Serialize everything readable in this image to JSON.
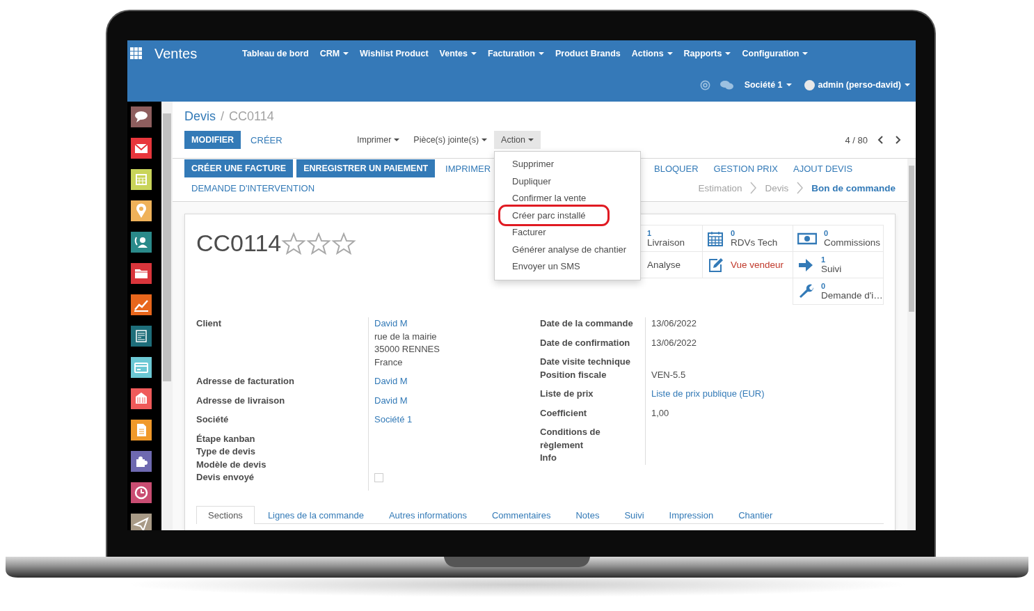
{
  "navbar": {
    "app_title": "Ventes",
    "menus": [
      {
        "label": "Tableau de bord",
        "dropdown": false
      },
      {
        "label": "CRM",
        "dropdown": true
      },
      {
        "label": "Wishlist Product",
        "dropdown": false
      },
      {
        "label": "Ventes",
        "dropdown": true
      },
      {
        "label": "Facturation",
        "dropdown": true
      },
      {
        "label": "Product Brands",
        "dropdown": false
      },
      {
        "label": "Actions",
        "dropdown": true
      },
      {
        "label": "Rapports",
        "dropdown": true
      },
      {
        "label": "Configuration",
        "dropdown": true
      }
    ],
    "company": "Société 1",
    "user": "admin (perso-david)"
  },
  "breadcrumbs": [
    {
      "label": "Devis"
    },
    {
      "label": "CC0114"
    }
  ],
  "breadcrumb_separator": "/",
  "edit_button": "MODIFIER",
  "create_button": "CRÉER",
  "dropdowns": [
    {
      "label": "Imprimer",
      "open": false
    },
    {
      "label": "Pièce(s) jointe(s)",
      "open": false
    },
    {
      "label": "Action",
      "open": true
    }
  ],
  "action_menu": [
    {
      "label": "Supprimer",
      "circled": false
    },
    {
      "label": "Dupliquer",
      "circled": false
    },
    {
      "label": "Confirmer la vente",
      "circled": false
    },
    {
      "label": "Créer parc installé",
      "circled": true
    },
    {
      "label": "Facturer",
      "circled": false
    },
    {
      "label": "Générer analyse de chantier",
      "circled": false
    },
    {
      "label": "Envoyer un SMS",
      "circled": false
    }
  ],
  "pager": "4 / 80",
  "header_buttons": [
    {
      "label": "CRÉER UNE FACTURE",
      "primary": true
    },
    {
      "label": "ENREGISTRER UN PAIEMENT",
      "primary": true
    },
    {
      "label": "IMPRIMER",
      "primary": false
    }
  ],
  "header_buttons_right": [
    {
      "label": "BLOQUER",
      "primary": false
    },
    {
      "label": "GESTION PRIX",
      "primary": false
    },
    {
      "label": "AJOUT DEVIS",
      "primary": false
    }
  ],
  "header_buttons_second": [
    {
      "label": "DEMANDE D'INTERVENTION",
      "primary": false
    }
  ],
  "stages": [
    {
      "label": "Estimation",
      "selected": false
    },
    {
      "label": "Devis",
      "selected": false
    },
    {
      "label": "Bon de commande",
      "selected": true
    }
  ],
  "record": {
    "title": "CC0114",
    "stars": 0
  },
  "button_box": [
    {
      "cells": [
        {
          "kind": "stat",
          "count": "1",
          "label": "Livraison"
        },
        {
          "kind": "stat",
          "count": "0",
          "label": "RDVs Tech"
        },
        {
          "kind": "stat",
          "count": "0",
          "label": "Commissions"
        }
      ]
    },
    {
      "cells": [
        {
          "kind": "plain",
          "label": "Analyse"
        },
        {
          "kind": "alert",
          "label": "Vue vendeur"
        },
        {
          "kind": "stat",
          "count": "1",
          "label": "Suivi"
        }
      ]
    },
    {
      "cells": [
        {
          "kind": "stat",
          "count": "0",
          "label": "Demande d'i…"
        }
      ]
    }
  ],
  "fields_left": [
    {
      "label": "Client",
      "kind": "link",
      "value": "David M",
      "lines": [
        "rue de la mairie",
        "35000 RENNES",
        "France"
      ]
    },
    {
      "label": "Adresse de facturation",
      "kind": "link",
      "value": "David M"
    },
    {
      "label": "Adresse de livraison",
      "kind": "link",
      "value": "David M"
    },
    {
      "label": "Société",
      "kind": "link",
      "value": "Société 1"
    },
    {
      "label": "Étape kanban",
      "kind": "empty"
    },
    {
      "label": "Type de devis",
      "kind": "empty"
    },
    {
      "label": "Modèle de devis",
      "kind": "empty"
    },
    {
      "label": "Devis envoyé",
      "kind": "checkbox",
      "checked": false
    }
  ],
  "fields_right": [
    {
      "label": "Date de la commande",
      "kind": "text",
      "value": "13/06/2022"
    },
    {
      "label": "Date de confirmation",
      "kind": "text",
      "value": "13/06/2022"
    },
    {
      "label": "Date visite technique",
      "kind": "empty"
    },
    {
      "label": "Position fiscale",
      "kind": "text",
      "value": "VEN-5.5"
    },
    {
      "label": "Liste de prix",
      "kind": "link",
      "value": "Liste de prix publique (EUR)"
    },
    {
      "label": "Coefficient",
      "kind": "text",
      "value": "1,00"
    },
    {
      "label": "Conditions de règlement",
      "kind": "empty"
    },
    {
      "label": "Info",
      "kind": "empty"
    }
  ],
  "tabs": [
    {
      "label": "Sections",
      "selected": true
    },
    {
      "label": "Lignes de la commande",
      "selected": false
    },
    {
      "label": "Autres informations",
      "selected": false
    },
    {
      "label": "Commentaires",
      "selected": false
    },
    {
      "label": "Notes",
      "selected": false
    },
    {
      "label": "Suivi",
      "selected": false
    },
    {
      "label": "Impression",
      "selected": false
    },
    {
      "label": "Chantier",
      "selected": false
    }
  ]
}
